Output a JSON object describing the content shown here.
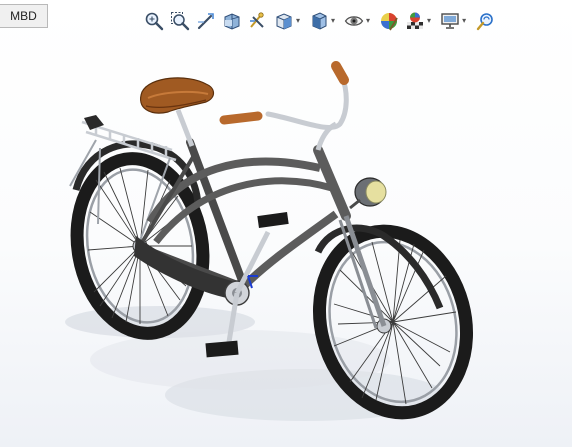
{
  "tab": {
    "label": "MBD"
  },
  "toolbar": {
    "tools": [
      {
        "name": "zoom-to-fit-icon"
      },
      {
        "name": "zoom-to-area-icon"
      },
      {
        "name": "previous-view-icon"
      },
      {
        "name": "section-view-icon"
      },
      {
        "name": "dynamic-annotation-views-icon"
      },
      {
        "name": "view-orientation-icon",
        "dropdown": true
      },
      {
        "name": "display-style-icon",
        "dropdown": true
      },
      {
        "name": "hide-show-items-icon",
        "dropdown": true
      },
      {
        "name": "edit-appearance-icon"
      },
      {
        "name": "apply-scene-icon",
        "dropdown": true
      },
      {
        "name": "view-settings-icon",
        "dropdown": true
      },
      {
        "name": "rotate-view-icon"
      }
    ],
    "dropdown_glyph": "▾"
  },
  "model": {
    "subject": "bicycle",
    "colors": {
      "frame": "#5c5c5c",
      "tire": "#1b1b1b",
      "seat": "#a05a22",
      "grip": "#b8692c",
      "headlight_lens": "#e6e0a0",
      "chrome": "#c8ccd2",
      "axis_blue": "#1a3bd0"
    }
  }
}
